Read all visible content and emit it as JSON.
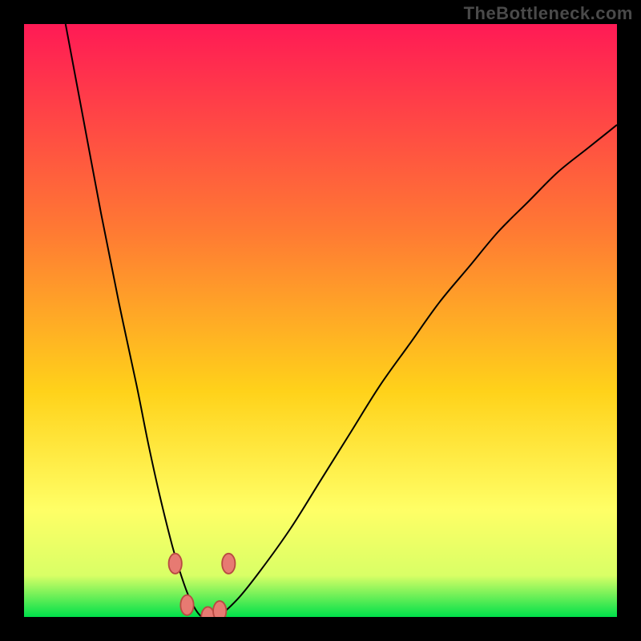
{
  "watermark": "TheBottleneck.com",
  "colors": {
    "page_bg": "#000000",
    "grad_top": "#ff1a55",
    "grad_mid1": "#ff7a33",
    "grad_mid2": "#ffd21a",
    "grad_mid3": "#ffff66",
    "grad_mid4": "#d9ff66",
    "grad_bottom": "#00e04a",
    "curve": "#000000",
    "marker_fill": "#e77a72",
    "marker_stroke": "#b94a42"
  },
  "chart_data": {
    "type": "line",
    "title": "",
    "xlabel": "",
    "ylabel": "",
    "xlim": [
      0,
      100
    ],
    "ylim": [
      0,
      100
    ],
    "series": [
      {
        "name": "bottleneck-curve",
        "x": [
          7,
          10,
          13,
          16,
          19,
          21,
          23,
          25,
          26.5,
          28,
          30,
          32.5,
          36,
          40,
          45,
          50,
          55,
          60,
          65,
          70,
          75,
          80,
          85,
          90,
          95,
          100
        ],
        "y": [
          100,
          84,
          68,
          53,
          39,
          29,
          20,
          12,
          7,
          3,
          0,
          0,
          3,
          8,
          15,
          23,
          31,
          39,
          46,
          53,
          59,
          65,
          70,
          75,
          79,
          83
        ]
      }
    ],
    "markers": [
      {
        "x": 25.5,
        "y": 9
      },
      {
        "x": 27.5,
        "y": 2
      },
      {
        "x": 31.0,
        "y": 0
      },
      {
        "x": 33.0,
        "y": 1
      },
      {
        "x": 34.5,
        "y": 9
      }
    ],
    "gradient_stops": [
      {
        "offset": 0,
        "color_key": "grad_top"
      },
      {
        "offset": 35,
        "color_key": "grad_mid1"
      },
      {
        "offset": 62,
        "color_key": "grad_mid2"
      },
      {
        "offset": 82,
        "color_key": "grad_mid3"
      },
      {
        "offset": 93,
        "color_key": "grad_mid4"
      },
      {
        "offset": 100,
        "color_key": "grad_bottom"
      }
    ]
  }
}
